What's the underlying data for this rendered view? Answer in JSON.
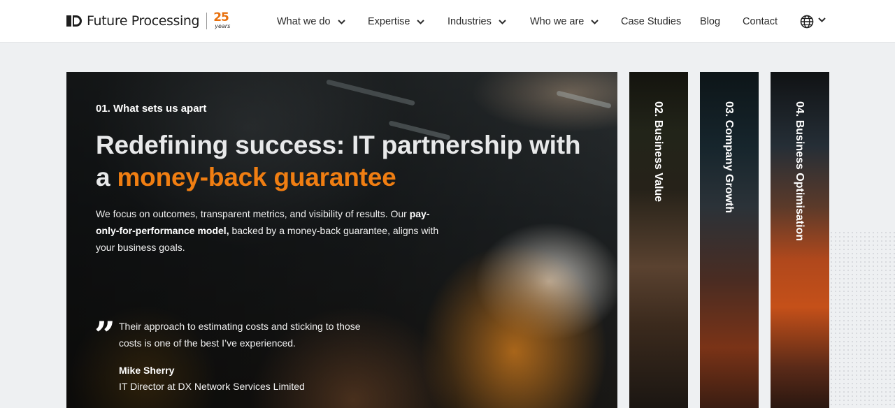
{
  "header": {
    "logo": {
      "name": "Future Processing",
      "badge_number": "25",
      "badge_text": "years"
    },
    "nav": [
      {
        "label": "What we do",
        "has_dropdown": true
      },
      {
        "label": "Expertise",
        "has_dropdown": true
      },
      {
        "label": "Industries",
        "has_dropdown": true
      },
      {
        "label": "Who we are",
        "has_dropdown": true
      },
      {
        "label": "Case Studies",
        "has_dropdown": false
      },
      {
        "label": "Blog",
        "has_dropdown": false
      },
      {
        "label": "Contact",
        "has_dropdown": false
      }
    ],
    "language_icon": "globe-icon"
  },
  "hero": {
    "eyebrow": "01. What sets us apart",
    "title_plain": "Redefining success: IT partnership with a ",
    "title_accent": "money-back guarantee",
    "desc_part1": "We focus on outcomes, transparent metrics, and visibility of results. Our ",
    "desc_bold": "pay-only-for-performance model,",
    "desc_part2": " backed by a money-back guarantee, aligns with your business goals.",
    "quote": {
      "text": "Their approach to estimating costs and sticking to those costs is one of the best I’ve experienced.",
      "author": "Mike Sherry",
      "role": "IT Director at DX Network Services Limited"
    }
  },
  "tabs": [
    {
      "label": "02. Business Value"
    },
    {
      "label": "03. Company Growth"
    },
    {
      "label": "04. Business Optimisation"
    }
  ],
  "colors": {
    "accent": "#f07e12",
    "header_bg": "#ffffff",
    "page_bg": "#eef0f2"
  }
}
